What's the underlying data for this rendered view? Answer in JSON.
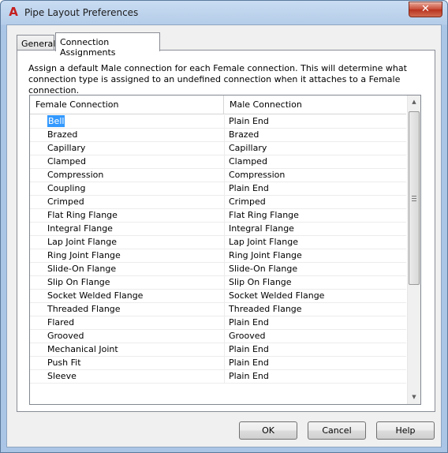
{
  "window": {
    "title": "Pipe Layout Preferences",
    "app_icon_letter": "A",
    "close_glyph": "✕"
  },
  "tabs": [
    {
      "label": "General",
      "active": false
    },
    {
      "label": "Connection Assignments",
      "active": true
    }
  ],
  "description": "Assign a default Male connection for each Female connection. This will determine what connection type is assigned to an undefined connection when it attaches to a Female connection.",
  "grid": {
    "columns": [
      "Female Connection",
      "Male Connection"
    ],
    "selected_row": 0,
    "rows": [
      {
        "female": "Bell",
        "male": "Plain End"
      },
      {
        "female": "Brazed",
        "male": "Brazed"
      },
      {
        "female": "Capillary",
        "male": "Capillary"
      },
      {
        "female": "Clamped",
        "male": "Clamped"
      },
      {
        "female": "Compression",
        "male": "Compression"
      },
      {
        "female": "Coupling",
        "male": "Plain End"
      },
      {
        "female": "Crimped",
        "male": "Crimped"
      },
      {
        "female": "Flat Ring Flange",
        "male": "Flat Ring Flange"
      },
      {
        "female": "Integral Flange",
        "male": "Integral Flange"
      },
      {
        "female": "Lap Joint Flange",
        "male": "Lap Joint Flange"
      },
      {
        "female": "Ring Joint Flange",
        "male": "Ring Joint Flange"
      },
      {
        "female": "Slide-On Flange",
        "male": "Slide-On Flange"
      },
      {
        "female": "Slip On Flange",
        "male": "Slip On Flange"
      },
      {
        "female": "Socket Welded Flange",
        "male": "Socket Welded Flange"
      },
      {
        "female": "Threaded Flange",
        "male": "Threaded Flange"
      },
      {
        "female": "Flared",
        "male": "Plain End"
      },
      {
        "female": "Grooved",
        "male": "Grooved"
      },
      {
        "female": "Mechanical Joint",
        "male": "Plain End"
      },
      {
        "female": "Push Fit",
        "male": "Plain End"
      },
      {
        "female": "Sleeve",
        "male": "Plain End"
      }
    ]
  },
  "buttons": {
    "ok": "OK",
    "cancel": "Cancel",
    "help": "Help"
  },
  "icons": {
    "app": "autocad-app-icon",
    "close": "close-icon",
    "scroll_up": "scroll-up-arrow-icon",
    "scroll_down": "scroll-down-arrow-icon"
  },
  "colors": {
    "selection": "#3399ff",
    "close_button": "#c74a35",
    "app_icon": "#c41e1e"
  }
}
